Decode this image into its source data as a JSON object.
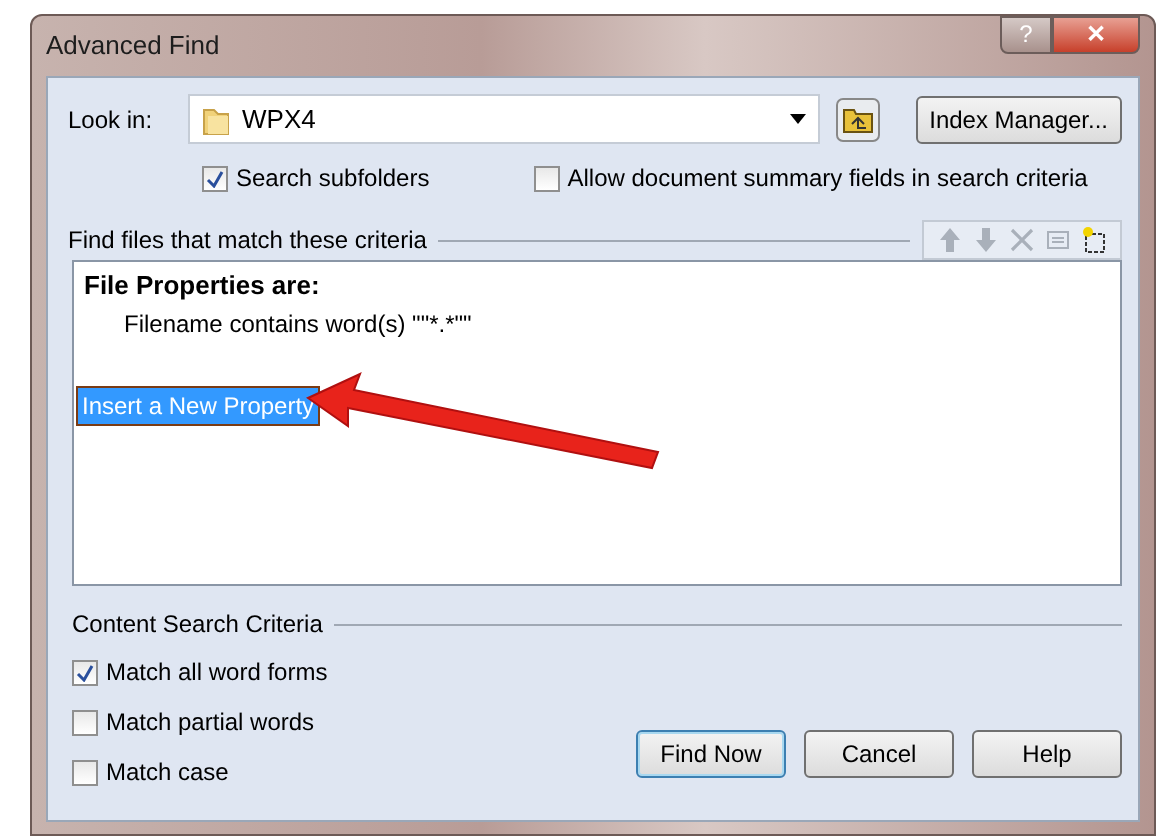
{
  "window": {
    "title": "Advanced Find",
    "title_buttons": [
      {
        "kind": "help",
        "label": "?"
      },
      {
        "kind": "close",
        "label": "✕"
      }
    ]
  },
  "look_in": {
    "label": "Look in:",
    "value": "WPX4",
    "index_button": "Index Manager..."
  },
  "options": [
    {
      "label": "Search subfolders",
      "checked": true
    },
    {
      "label": "Allow document summary fields in search criteria",
      "checked": false
    }
  ],
  "criteria": {
    "heading": "Find files that match these criteria",
    "toolbar": [
      {
        "kind": "up",
        "disabled": true
      },
      {
        "kind": "down",
        "disabled": true
      },
      {
        "kind": "delete",
        "disabled": true
      },
      {
        "kind": "properties",
        "disabled": true
      },
      {
        "kind": "new",
        "disabled": false
      }
    ],
    "group_title": "File Properties are:",
    "conditions": [
      "Filename contains word(s) \"\"*.*\"\""
    ],
    "insert_item": {
      "label": "Insert a New Property",
      "selected": true
    }
  },
  "content_search": {
    "heading": "Content Search Criteria",
    "options": [
      {
        "label": "Match all word forms",
        "checked": true
      },
      {
        "label": "Match partial words",
        "checked": false
      },
      {
        "label": "Match case",
        "checked": false
      }
    ]
  },
  "buttons": [
    {
      "label": "Find Now",
      "default": true
    },
    {
      "label": "Cancel",
      "default": false
    },
    {
      "label": "Help",
      "default": false
    }
  ]
}
